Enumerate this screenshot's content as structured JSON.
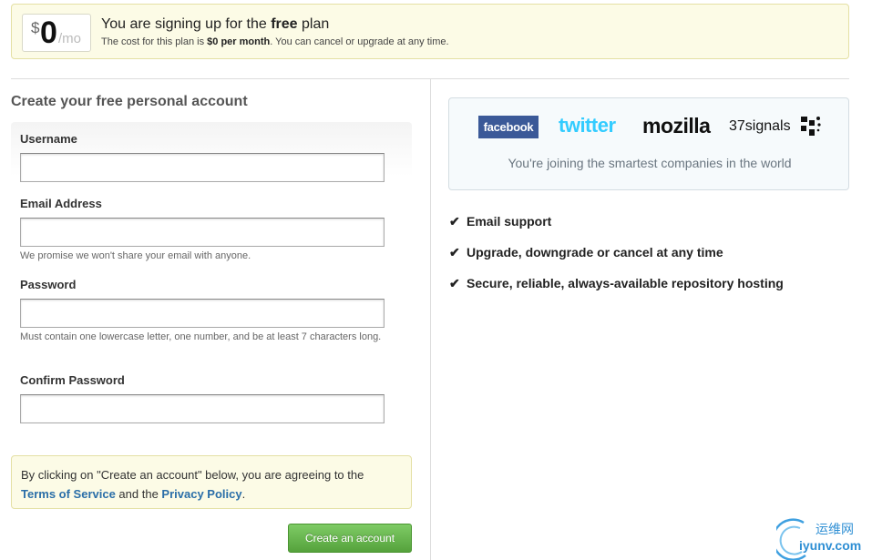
{
  "plan": {
    "price_symbol": "$",
    "price_amount": "0",
    "price_unit": "/mo",
    "title_prefix": "You are signing up for the ",
    "title_bold": "free",
    "title_suffix": " plan",
    "sub_prefix": "The cost for this plan is ",
    "sub_bold": "$0 per month",
    "sub_suffix": ". You can cancel or upgrade at any time."
  },
  "form": {
    "heading": "Create your free personal account",
    "username_label": "Username",
    "username_value": "",
    "email_label": "Email Address",
    "email_value": "",
    "email_note": "We promise we won't share your email with anyone.",
    "password_label": "Password",
    "password_value": "",
    "password_note": "Must contain one lowercase letter, one number, and be at least 7 characters long.",
    "confirm_label": "Confirm Password",
    "confirm_value": ""
  },
  "agreement": {
    "prefix": "By clicking on \"Create an account\" below, you are agreeing to the",
    "tos_link": "Terms of Service",
    "middle": " and the ",
    "privacy_link": "Privacy Policy",
    "suffix": "."
  },
  "submit_label": "Create an account",
  "logos": {
    "facebook": "facebook",
    "twitter": "twitter",
    "mozilla": "mozilla",
    "signals": "37signals",
    "caption": "You're joining the smartest companies in the world"
  },
  "features": [
    "Email support",
    "Upgrade, downgrade or cancel at any time",
    "Secure, reliable, always-available repository hosting"
  ],
  "watermark": {
    "cn": "运维网",
    "en": "iyunv.com"
  },
  "colors": {
    "link": "#2a6ea8",
    "button": "#55a23c",
    "banner_bg": "#fcfbe6",
    "facebook": "#3b5998",
    "twitter": "#33ccff"
  }
}
